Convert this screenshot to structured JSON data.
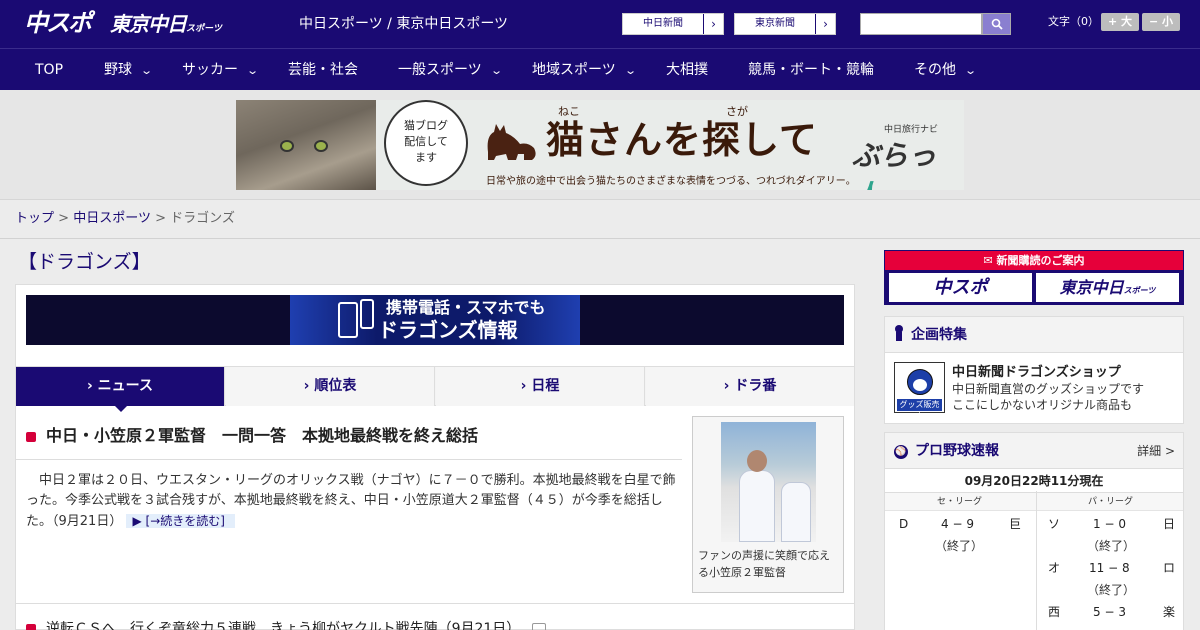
{
  "header": {
    "logo_chuspo": "中スポ",
    "logo_tokyo": "東京中日",
    "logo_tokyo_small": "スポーツ",
    "site_title": "中日スポーツ / 東京中日スポーツ",
    "ext_links": [
      {
        "label": "中日新聞",
        "arrow": "›"
      },
      {
        "label": "東京新聞",
        "arrow": "›"
      }
    ],
    "search_placeholder": "",
    "search_icon": "search-icon",
    "fontsize_label": "文字（0）",
    "fontsize_plus": "+ 大",
    "fontsize_minus": "− 小"
  },
  "nav": {
    "items": [
      {
        "label": "TOP",
        "has_dropdown": false
      },
      {
        "label": "野球",
        "has_dropdown": true
      },
      {
        "label": "サッカー",
        "has_dropdown": true
      },
      {
        "label": "芸能・社会",
        "has_dropdown": false
      },
      {
        "label": "一般スポーツ",
        "has_dropdown": true
      },
      {
        "label": "地域スポーツ",
        "has_dropdown": true
      },
      {
        "label": "大相撲",
        "has_dropdown": false
      },
      {
        "label": "競馬・ボート・競輪",
        "has_dropdown": false
      },
      {
        "label": "その他",
        "has_dropdown": true
      }
    ],
    "chevron": "⌄"
  },
  "banner": {
    "bubble_text": "猫ブログ\n配信して\nます",
    "ruby_neko": "ねこ",
    "ruby_saga": "さが",
    "title": "猫さんを探して",
    "subtitle": "日常や旅の途中で出会う猫たちのさまざまな表情をつづる、つれづれダイアリー。",
    "brand_small": "中日旅行ナビ",
    "brand_main": "ぶらっ",
    "brand_accent": "人"
  },
  "breadcrumb": {
    "items": [
      "トップ",
      "中日スポーツ",
      "ドラゴンズ"
    ],
    "separator": ">"
  },
  "main": {
    "heading": "【ドラゴンズ】",
    "mobile_banner_line1": "携帯電話・スマホでも",
    "mobile_banner_line2": "ドラゴンズ情報",
    "tabs": [
      {
        "label": "› ニュース",
        "active": true
      },
      {
        "label": "› 順位表",
        "active": false
      },
      {
        "label": "› 日程",
        "active": false
      },
      {
        "label": "› ドラ番",
        "active": false
      }
    ],
    "lead": {
      "title": "中日・小笠原２軍監督　一問一答　本拠地最終戦を終え総括",
      "body": "中日２軍は２０日、ウエスタン・リーグのオリックス戦（ナゴヤ）に７－０で勝利。本拠地最終戦を白星で飾った。今季公式戦を３試合残すが、本拠地最終戦を終え、中日・小笠原道大２軍監督（４５）が今季を総括した。（9月21日）",
      "readmore": "▶ [→続きを読む]",
      "photo_caption": "ファンの声援に笑顔で応える小笠原２軍監督"
    },
    "list": [
      {
        "title": "逆転ＣＳへ　行くぞ竜総力５連戦　きょう柳がヤクルト戦先陣（9月21日）"
      }
    ]
  },
  "sidebar": {
    "subscribe_head": "新聞購読のご案内",
    "subscribe_logo1": "中スポ",
    "subscribe_logo2": "東京中日",
    "subscribe_logo2_small": "スポーツ",
    "special": {
      "heading": "企画特集",
      "shop_icon_text": "グッズ販売中",
      "title": "中日新聞ドラゴンズショップ",
      "desc_line1": "中日新聞直営のグッズショップです",
      "desc_line2": "ここにしかないオリジナル商品も"
    },
    "scores": {
      "heading": "プロ野球速報",
      "detail": "詳細 >",
      "updated": "09月20日22時11分現在",
      "central_label": "セ・リーグ",
      "pacific_label": "パ・リーグ",
      "central": [
        {
          "home": "D",
          "score": "4 − 9",
          "away": "巨",
          "status": "（終了）"
        }
      ],
      "pacific": [
        {
          "home": "ソ",
          "score": "1 − 0",
          "away": "日",
          "status": "（終了）"
        },
        {
          "home": "オ",
          "score": "11 − 8",
          "away": "ロ",
          "status": "（終了）"
        },
        {
          "home": "西",
          "score": "5 − 3",
          "away": "楽",
          "status": "（終了）"
        }
      ]
    }
  }
}
